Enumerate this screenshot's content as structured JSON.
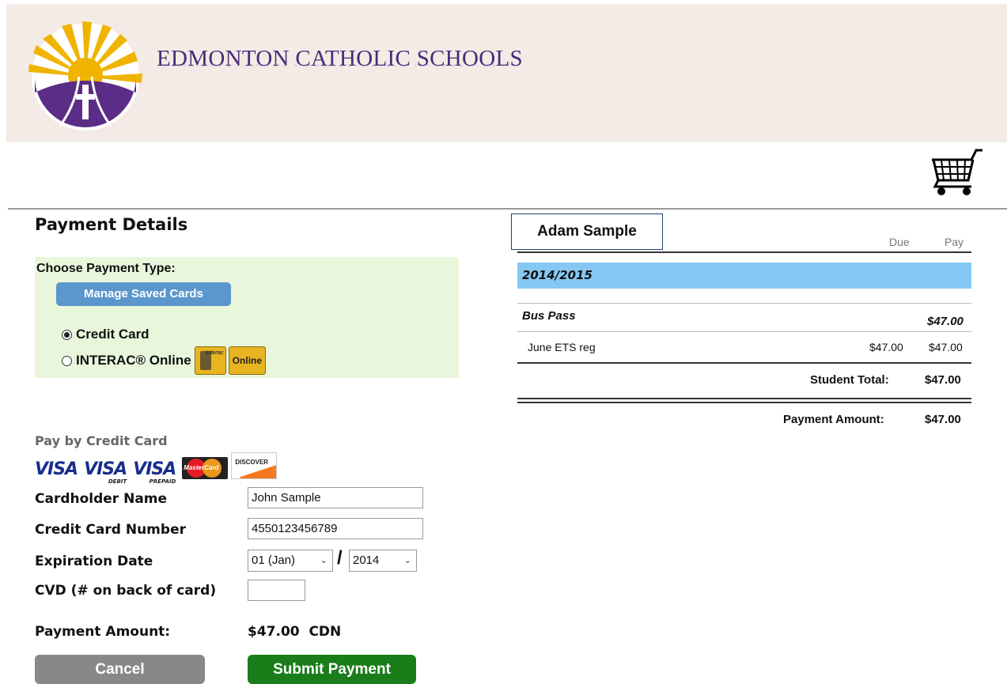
{
  "header": {
    "school_name": "EDMONTON CATHOLIC SCHOOLS"
  },
  "payment": {
    "title": "Payment Details",
    "choose_label": "Choose Payment Type:",
    "manage_cards_label": "Manage Saved Cards",
    "options": [
      {
        "label": "Credit Card",
        "selected": true
      },
      {
        "label": "INTERAC® Online",
        "selected": false
      }
    ],
    "online_badge": "Online",
    "interac_badge": "Interac"
  },
  "credit_card": {
    "heading": "Pay by Credit Card",
    "logos": {
      "visa": "VISA",
      "visa_debit": "VISA",
      "visa_debit_sub": "DEBIT",
      "visa_prepaid": "VISA",
      "visa_prepaid_sub": "PREPAID",
      "mastercard": "MasterCard",
      "discover": "DISCOVER"
    },
    "cardholder_label": "Cardholder Name",
    "cardholder_value": "John Sample",
    "number_label": "Credit Card Number",
    "number_value": "4550123456789",
    "expiry_label": "Expiration Date",
    "expiry_month": "01 (Jan)",
    "expiry_sep": "/",
    "expiry_year": "2014",
    "cvd_label": "CVD (# on back of card)",
    "cvd_value": "",
    "amount_label": "Payment Amount:",
    "amount_value": "$47.00  CDN",
    "cancel_label": "Cancel",
    "submit_label": "Submit Payment"
  },
  "summary": {
    "student_name": "Adam Sample",
    "col_due": "Due",
    "col_pay": "Pay",
    "year": "2014/2015",
    "category": "Bus Pass",
    "category_amount": "$47.00",
    "item_name": "June ETS reg",
    "item_due": "$47.00",
    "item_pay": "$47.00",
    "student_total_label": "Student Total:",
    "student_total_value": "$47.00",
    "payment_amount_label": "Payment Amount:",
    "payment_amount_value": "$47.00"
  },
  "colors": {
    "banner_bg": "#f4ebe6",
    "brand_purple": "#4b2a7a",
    "brand_gold": "#f0b400",
    "payment_box_bg": "#e8f7dc",
    "manage_button": "#5b96cc",
    "year_bar": "#86c8f4",
    "cancel_button": "#888888",
    "submit_button": "#1a7d1a"
  }
}
